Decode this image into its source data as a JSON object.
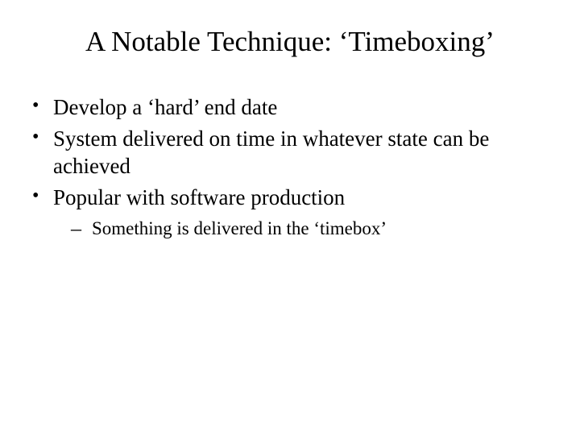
{
  "title": "A Notable Technique: ‘Timeboxing’",
  "bullets": [
    {
      "text": "Develop a ‘hard’ end date"
    },
    {
      "text": "System delivered on time in whatever state can be achieved"
    },
    {
      "text": "Popular with software production",
      "sub": [
        "Something is delivered in the ‘timebox’"
      ]
    }
  ]
}
